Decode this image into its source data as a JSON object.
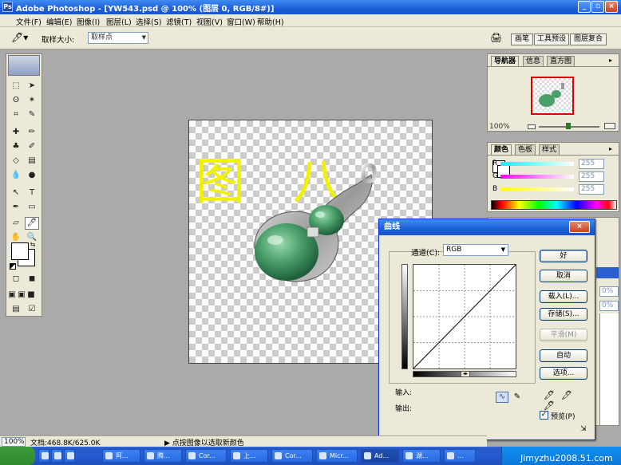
{
  "app": {
    "title": "Adobe Photoshop - [YW543.psd @ 100% (图层 0, RGB/8#)]",
    "icon": "Ps"
  },
  "window_buttons": {
    "minimize": "_",
    "restore": "▫",
    "close": "×"
  },
  "menu": [
    "文件(F)",
    "编辑(E)",
    "图像(I)",
    "图层(L)",
    "选择(S)",
    "滤镜(T)",
    "视图(V)",
    "窗口(W)",
    "帮助(H)"
  ],
  "options_bar": {
    "sample_size_label": "取样大小:",
    "sample_size_value": "取样点",
    "tabs": [
      "画笔",
      "工具预设",
      "图层复合"
    ]
  },
  "canvas": {
    "overlay_text": "图 八",
    "text_color": "#f2f200"
  },
  "navigator": {
    "tabs": [
      "导航器",
      "信息",
      "直方图"
    ],
    "zoom": "100%"
  },
  "color_panel": {
    "tabs": [
      "颜色",
      "色板",
      "样式"
    ],
    "channels": [
      {
        "name": "R",
        "value": "255"
      },
      {
        "name": "G",
        "value": "255"
      },
      {
        "name": "B",
        "value": "255"
      }
    ]
  },
  "layers_panel": {
    "fields": [
      "0%",
      "0%"
    ]
  },
  "curves_dialog": {
    "title": "曲线",
    "close_label": "×",
    "channel_label": "通道(C):",
    "channel_value": "RGB",
    "input_label": "输入:",
    "output_label": "输出:",
    "buttons": {
      "ok": "好",
      "cancel": "取消",
      "load": "载入(L)...",
      "save": "存储(S)...",
      "smooth": "平滑(M)",
      "auto": "自动",
      "options": "选项..."
    },
    "preview_label": "预览(P)",
    "preview_checked": true
  },
  "status_bar": {
    "zoom": "100%",
    "doc_info": "文档:468.8K/625.0K",
    "hint": "▶ 点按图像以选取新颜色"
  },
  "taskbar": {
    "items": [
      "阿...",
      "腾...",
      "Cor...",
      "上...",
      "Cor...",
      "Micr...",
      "Ad...",
      "湖...",
      "..."
    ],
    "watermark": "Jimyzhu2008.51.com"
  }
}
